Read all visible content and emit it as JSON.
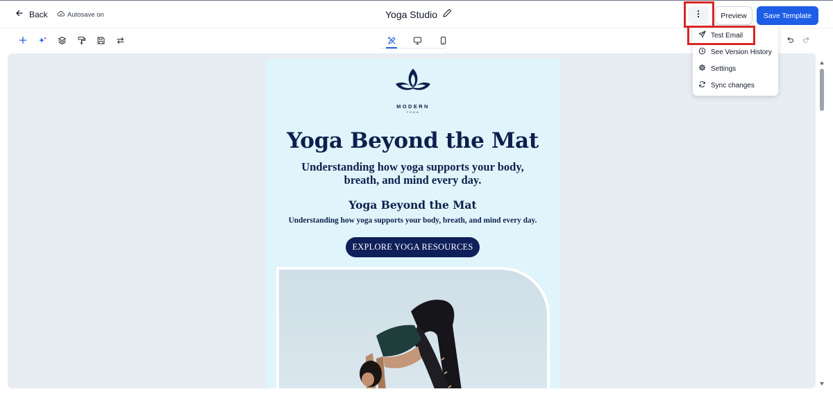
{
  "header": {
    "back_label": "Back",
    "autosave_label": "Autosave on",
    "template_title": "Yoga Studio",
    "preview_label": "Preview",
    "save_label": "Save Template"
  },
  "toolbar": {
    "left_tools": [
      "add-icon",
      "ai-sparkle-icon",
      "layers-icon",
      "paint-roller-icon",
      "save-icon",
      "swap-icon"
    ],
    "devices": [
      "design-tools-icon",
      "desktop-icon",
      "mobile-icon"
    ],
    "active_device": "design-tools-icon",
    "history": [
      "undo-icon",
      "redo-icon"
    ]
  },
  "menu": {
    "items": [
      {
        "label": "Test Email",
        "icon": "send-icon"
      },
      {
        "label": "See Version History",
        "icon": "history-icon"
      },
      {
        "label": "Settings",
        "icon": "gear-icon"
      },
      {
        "label": "Sync changes",
        "icon": "sync-icon"
      }
    ]
  },
  "email": {
    "logo_name": "MODERN",
    "logo_sub": "YOGA",
    "headline": "Yoga Beyond the Mat",
    "subheadline": "Understanding how yoga supports your body, breath, and mind every day.",
    "secondary_headline": "Yoga Beyond the Mat",
    "secondary_subheadline": "Understanding how yoga supports your body, breath, and mind every day.",
    "cta_label": "EXPLORE YOGA RESOURCES"
  },
  "colors": {
    "accent": "#1e5de6",
    "highlight_box": "#d92626",
    "email_background": "#e0f5fb",
    "navy": "#0d1f4c",
    "canvas_background": "#e8ecf3"
  }
}
